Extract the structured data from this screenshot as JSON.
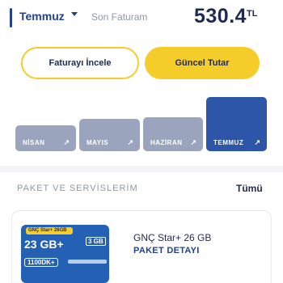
{
  "header": {
    "selected_month": "Temmuz",
    "last_bill_label": "Son Faturam",
    "amount": "530.4",
    "currency": "TL"
  },
  "actions": {
    "view_invoice": "Faturayı İncele",
    "current_amount": "Güncel Tutar"
  },
  "months": [
    {
      "label": "NİSAN",
      "arrow": "↗"
    },
    {
      "label": "MAYIS",
      "arrow": "↗"
    },
    {
      "label": "HAZİRAN",
      "arrow": "↗"
    },
    {
      "label": "TEMMUZ",
      "arrow": "↗"
    }
  ],
  "packages": {
    "section_title": "PAKET VE SERVİSLERİM",
    "see_all": "Tümü",
    "card": {
      "image_tag": "GNÇ Star+ 26GB",
      "image_gb": "23 GB+",
      "image_extra": "3 GB",
      "image_minutes": "1100DK+",
      "name": "GNÇ Star+ 26 GB",
      "detail_link": "PAKET DETAYI"
    }
  },
  "colors": {
    "accent_yellow": "#f5cd2a",
    "navy": "#1e2a52",
    "active_bar": "#2d55a8",
    "inactive_bar": "#9aa5bd"
  }
}
